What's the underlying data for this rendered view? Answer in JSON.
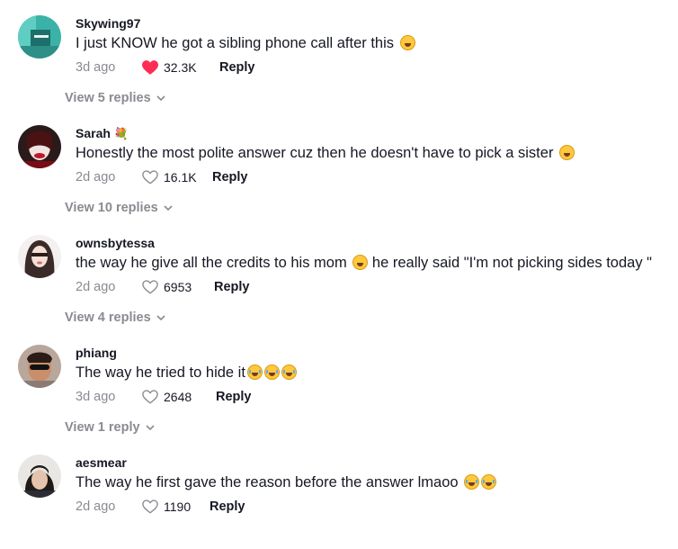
{
  "colors": {
    "liked": "#fe2c55",
    "muted": "#8a8b91",
    "text": "#161823"
  },
  "comments": [
    {
      "username": "Skywing97",
      "text": "I just KNOW he got a sibling phone call after this",
      "time": "3d ago",
      "likes": "32.3K",
      "liked": true,
      "reply": "Reply",
      "view_replies": "View 5 replies",
      "emoji": "face-with-tears-of-joy"
    },
    {
      "username": "Sarah",
      "username_emoji": "💐",
      "text": "Honestly the most polite answer cuz then he doesn't have to pick a sister",
      "time": "2d ago",
      "likes": "16.1K",
      "liked": false,
      "reply": "Reply",
      "view_replies": "View 10 replies",
      "emoji": "face-with-tears-of-joy"
    },
    {
      "username": "ownsbytessa",
      "text": "the way he give all the credits to his mom",
      "text2": "he really said \"I'm not picking sides today \"",
      "time": "2d ago",
      "likes": "6953",
      "liked": false,
      "reply": "Reply",
      "view_replies": "View 4 replies",
      "emoji": "rolling-on-floor-laughing"
    },
    {
      "username": "phiang",
      "text": "The way he tried to hide it",
      "time": "3d ago",
      "likes": "2648",
      "liked": false,
      "reply": "Reply",
      "view_replies": "View 1 reply",
      "emoji": "loudly-crying-face x3"
    },
    {
      "username": "aesmear",
      "text": "The way he first gave the reason before the answer lmaoo",
      "time": "2d ago",
      "likes": "1190",
      "liked": false,
      "reply": "Reply",
      "emoji": "loudly-crying-face x2"
    }
  ]
}
